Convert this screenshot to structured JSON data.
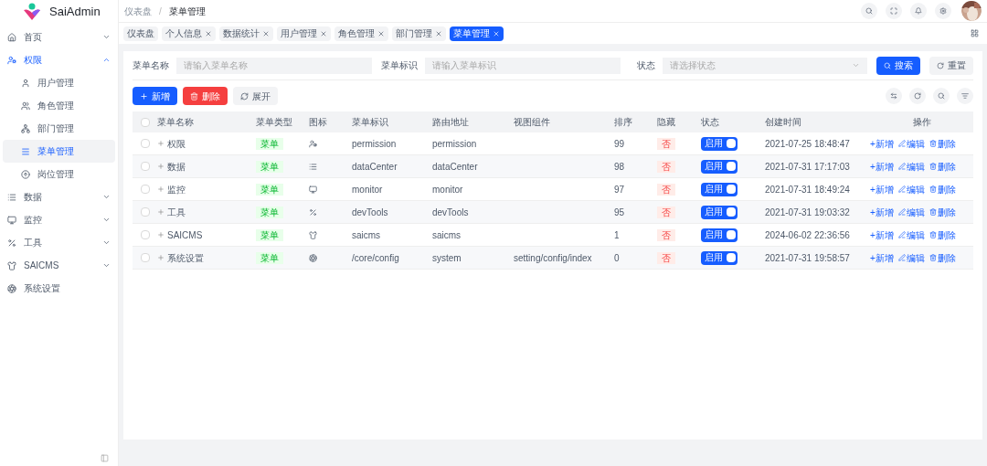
{
  "app": {
    "name": "SaiAdmin"
  },
  "breadcrumb": [
    "仪表盘",
    "菜单管理"
  ],
  "breadcrumb_separator": "/",
  "sidebar": {
    "items": [
      {
        "label": "首页",
        "selected": false,
        "expanded": false
      },
      {
        "label": "权限",
        "selected": true,
        "expanded": true,
        "children": [
          {
            "label": "用户管理",
            "selected": false
          },
          {
            "label": "角色管理",
            "selected": false
          },
          {
            "label": "部门管理",
            "selected": false
          },
          {
            "label": "菜单管理",
            "selected": true
          },
          {
            "label": "岗位管理",
            "selected": false
          }
        ]
      },
      {
        "label": "数据",
        "selected": false,
        "expanded": false
      },
      {
        "label": "监控",
        "selected": false,
        "expanded": false
      },
      {
        "label": "工具",
        "selected": false,
        "expanded": false
      },
      {
        "label": "SAICMS",
        "selected": false,
        "expanded": false
      },
      {
        "label": "系统设置",
        "selected": false,
        "kind": "leaf"
      }
    ]
  },
  "tabs": [
    {
      "label": "仪表盘",
      "selected": false,
      "closable": false
    },
    {
      "label": "个人信息",
      "selected": false,
      "closable": true
    },
    {
      "label": "数据统计",
      "selected": false,
      "closable": true
    },
    {
      "label": "用户管理",
      "selected": false,
      "closable": true
    },
    {
      "label": "角色管理",
      "selected": false,
      "closable": true
    },
    {
      "label": "部门管理",
      "selected": false,
      "closable": true
    },
    {
      "label": "菜单管理",
      "selected": true,
      "closable": true
    }
  ],
  "filters": [
    {
      "kind": "input",
      "label": "菜单名称",
      "placeholder": "请输入菜单名称"
    },
    {
      "kind": "input",
      "label": "菜单标识",
      "placeholder": "请输入菜单标识"
    },
    {
      "kind": "select",
      "label": "状态",
      "placeholder": "请选择状态"
    }
  ],
  "filter_buttons": [
    {
      "kind": "primary",
      "label": "搜索"
    },
    {
      "kind": "plain",
      "label": "重置"
    }
  ],
  "toolbar": [
    {
      "kind": "primary",
      "label": "新增"
    },
    {
      "kind": "danger",
      "label": "删除"
    },
    {
      "kind": "plain",
      "label": "展开"
    }
  ],
  "table": {
    "header_checked": false,
    "columns": [
      "菜单名称",
      "菜单类型",
      "图标",
      "菜单标识",
      "路由地址",
      "视图组件",
      "排序",
      "隐藏",
      "状态",
      "创建时间",
      "操作"
    ],
    "rows": [
      {
        "checked": false,
        "name": "权限",
        "type": "菜单",
        "code": "permission",
        "route": "permission",
        "sort": "99",
        "hidden": "否",
        "status": {
          "label": "启用",
          "on": true
        },
        "created": "2021-07-25 18:48:47",
        "actions": [
          "+新增",
          "编辑",
          "删除"
        ]
      },
      {
        "checked": false,
        "name": "数据",
        "type": "菜单",
        "code": "dataCenter",
        "route": "dataCenter",
        "sort": "98",
        "hidden": "否",
        "status": {
          "label": "启用",
          "on": true
        },
        "created": "2021-07-31 17:17:03",
        "actions": [
          "+新增",
          "编辑",
          "删除"
        ]
      },
      {
        "checked": false,
        "name": "监控",
        "type": "菜单",
        "code": "monitor",
        "route": "monitor",
        "sort": "97",
        "hidden": "否",
        "status": {
          "label": "启用",
          "on": true
        },
        "created": "2021-07-31 18:49:24",
        "actions": [
          "+新增",
          "编辑",
          "删除"
        ]
      },
      {
        "checked": false,
        "name": "工具",
        "type": "菜单",
        "code": "devTools",
        "route": "devTools",
        "sort": "95",
        "hidden": "否",
        "status": {
          "label": "启用",
          "on": true
        },
        "created": "2021-07-31 19:03:32",
        "actions": [
          "+新增",
          "编辑",
          "删除"
        ]
      },
      {
        "checked": false,
        "name": "SAICMS",
        "type": "菜单",
        "code": "saicms",
        "route": "saicms",
        "sort": "1",
        "hidden": "否",
        "status": {
          "label": "启用",
          "on": true
        },
        "created": "2024-06-02 22:36:56",
        "actions": [
          "+新增",
          "编辑",
          "删除"
        ]
      },
      {
        "checked": false,
        "name": "系统设置",
        "type": "菜单",
        "code": "/core/config",
        "route": "system",
        "view": "setting/config/index",
        "sort": "0",
        "hidden": "否",
        "status": {
          "label": "启用",
          "on": true
        },
        "created": "2021-07-31 19:58:57",
        "actions": [
          "+新增",
          "编辑",
          "删除"
        ]
      }
    ]
  }
}
